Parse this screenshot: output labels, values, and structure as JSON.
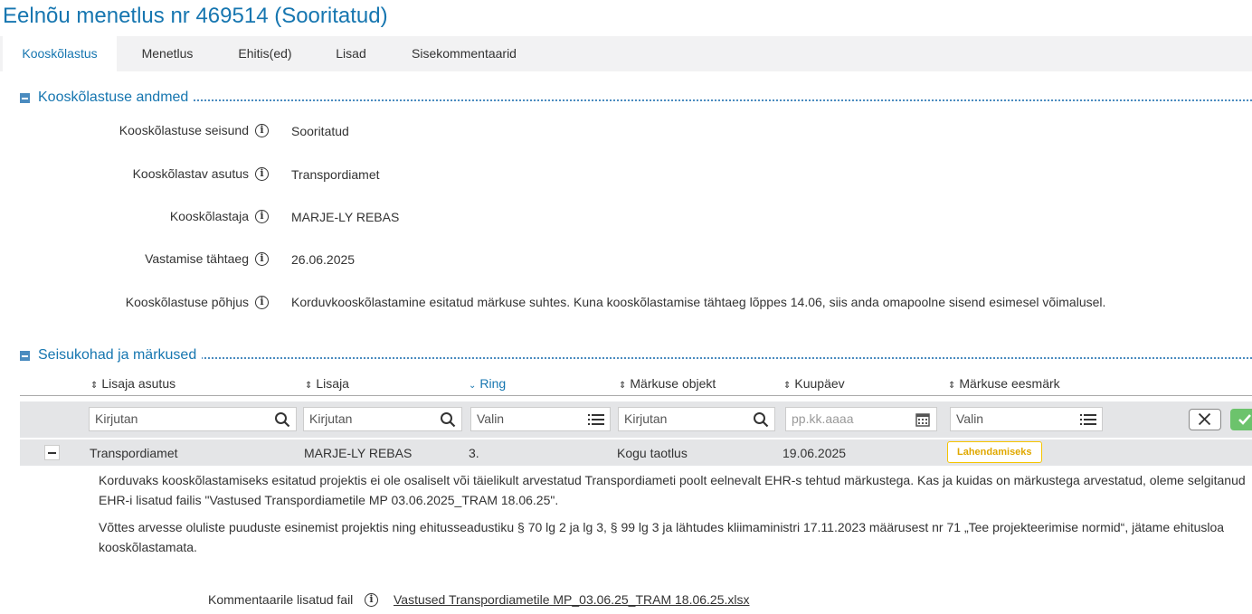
{
  "page": {
    "title": "Eelnõu menetlus nr 469514 (Sooritatud)"
  },
  "tabs": [
    {
      "label": "Kooskõlastus",
      "active": true
    },
    {
      "label": "Menetlus"
    },
    {
      "label": "Ehitis(ed)"
    },
    {
      "label": "Lisad"
    },
    {
      "label": "Sisekommentaarid"
    }
  ],
  "section1": {
    "title": "Kooskõlastuse andmed",
    "fields": [
      {
        "label": "Kooskõlastuse seisund",
        "value": "Sooritatud"
      },
      {
        "label": "Kooskõlastav asutus",
        "value": "Transpordiamet"
      },
      {
        "label": "Kooskõlastaja",
        "value": "MARJE-LY REBAS"
      },
      {
        "label": "Vastamise tähtaeg",
        "value": "26.06.2025"
      },
      {
        "label": "Kooskõlastuse põhjus",
        "value": "Korduvkooskõlastamine esitatud märkuse suhtes. Kuna kooskõlastamise tähtaeg lõppes 14.06, siis anda omapoolne sisend esimesel võimalusel."
      }
    ]
  },
  "section2": {
    "title": "Seisukohad ja märkused",
    "columns": [
      "Lisaja asutus",
      "Lisaja",
      "Ring",
      "Märkuse objekt",
      "Kuupäev",
      "Märkuse eesmärk"
    ],
    "filters": {
      "asutus_placeholder": "Kirjutan",
      "lisaja_placeholder": "Kirjutan",
      "ring_value": "Valin",
      "objekt_placeholder": "Kirjutan",
      "kuupaev_placeholder": "pp.kk.aaaa",
      "eesmark_value": "Valin"
    },
    "row": {
      "asutus": "Transpordiamet",
      "lisaja": "MARJE-LY REBAS",
      "ring": "3.",
      "objekt": "Kogu taotlus",
      "kuupaev": "19.06.2025",
      "eesmark": "Lahendamiseks"
    },
    "comment_p1": "Korduvaks kooskõlastamiseks esitatud projektis ei ole osaliselt või täielikult arvestatud Transpordiameti poolt eelnevalt EHR-s tehtud märkustega. Kas ja kuidas on märkustega arvestatud, oleme selgitanud EHR-i lisatud failis \"Vastused Transpordiametile MP 03.06.2025_TRAM 18.06.25\".",
    "comment_p2": "Võttes arvesse oluliste puuduste esinemist projektis ning ehitusseadustiku § 70 lg 2 ja lg 3, § 99 lg 3 ja lähtudes kliimaministri 17.11.2023 määrusest nr 71 „Tee projekteerimise normid“, jätame ehitusloa kooskõlastamata.",
    "file_label": "Kommentaarile lisatud fail",
    "file_name": "Vastused Transpordiametile MP_03.06.25_TRAM 18.06.25.xlsx"
  },
  "colors": {
    "accent": "#1676b0",
    "badge": "#f5c400",
    "confirm": "#6cc36c"
  }
}
